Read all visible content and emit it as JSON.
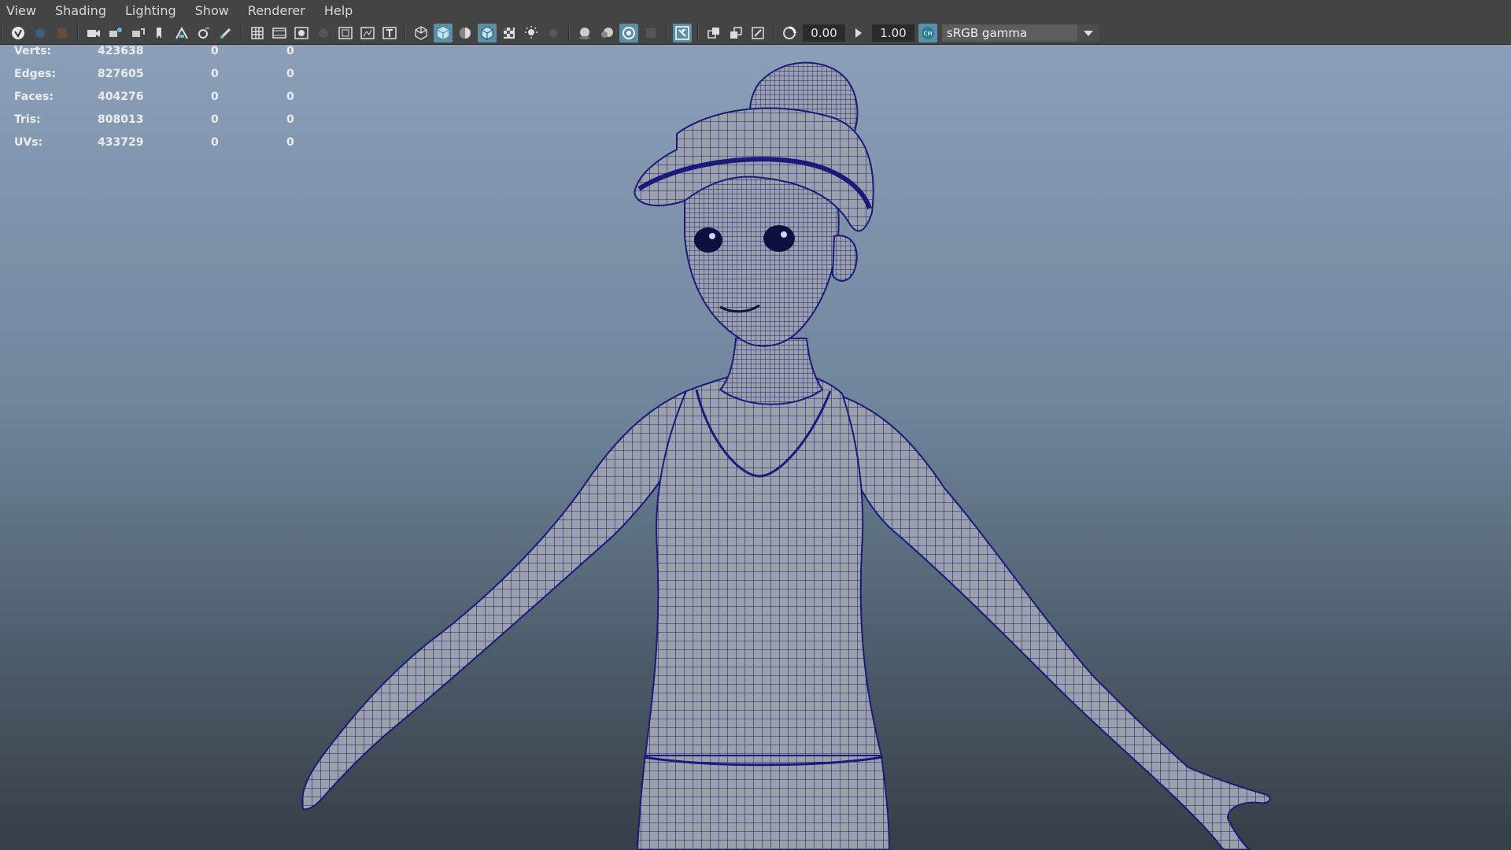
{
  "menu": [
    "View",
    "Shading",
    "Lighting",
    "Show",
    "Renderer",
    "Help"
  ],
  "toolbar": {
    "exposure": "0.00",
    "gamma": "1.00",
    "color_space": "sRGB gamma"
  },
  "hud": {
    "rows": [
      {
        "label": "Verts:",
        "value": "423638",
        "sel": "0",
        "uv_sel": "0"
      },
      {
        "label": "Edges:",
        "value": "827605",
        "sel": "0",
        "uv_sel": "0"
      },
      {
        "label": "Faces:",
        "value": "404276",
        "sel": "0",
        "uv_sel": "0"
      },
      {
        "label": "Tris:",
        "value": "808013",
        "sel": "0",
        "uv_sel": "0"
      },
      {
        "label": "UVs:",
        "value": "433729",
        "sel": "0",
        "uv_sel": "0"
      }
    ]
  },
  "colors": {
    "accent": "#5c8ea8",
    "wireframe": "#1a1a7a",
    "mesh_fill": "#9aa1ab",
    "viewport_top": "#8ba0b8",
    "viewport_bottom": "#363e46"
  },
  "icons": [
    "select-icon",
    "lasso-icon",
    "paint-icon",
    "camera-icon",
    "camera-attr-icon",
    "bookmark-icon",
    "image-plane-icon",
    "2d-pan-icon",
    "grease-pencil-icon",
    "grid-icon",
    "film-gate-icon",
    "resolution-gate-icon",
    "gate-mask-icon",
    "field-chart-icon",
    "safe-action-icon",
    "safe-title-icon",
    "wireframe-icon",
    "smooth-shade-icon",
    "default-material-icon",
    "wireframe-on-shaded-icon",
    "textured-icon",
    "lights-icon",
    "shadows-icon",
    "screen-space-ao-icon",
    "motion-blur-icon",
    "anti-aliasing-icon",
    "depth-of-field-icon",
    "isolate-select-icon",
    "xray-icon",
    "xray-joints-icon",
    "xray-components-icon",
    "exposure-icon",
    "gamma-icon",
    "color-management-icon"
  ]
}
